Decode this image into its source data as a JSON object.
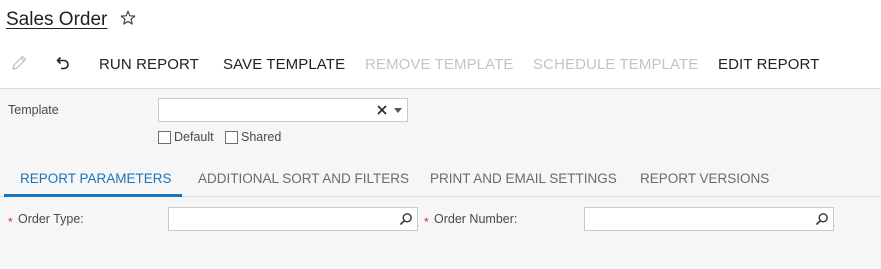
{
  "header": {
    "title": "Sales Order"
  },
  "toolbar": {
    "run_report": "RUN REPORT",
    "save_template": "SAVE TEMPLATE",
    "remove_template": "REMOVE TEMPLATE",
    "schedule_template": "SCHEDULE TEMPLATE",
    "edit_report": "EDIT REPORT"
  },
  "template": {
    "label": "Template",
    "value": "",
    "default_label": "Default",
    "shared_label": "Shared",
    "default_checked": false,
    "shared_checked": false
  },
  "tabs": [
    {
      "label": "REPORT PARAMETERS",
      "active": true
    },
    {
      "label": "ADDITIONAL SORT AND FILTERS",
      "active": false
    },
    {
      "label": "PRINT AND EMAIL SETTINGS",
      "active": false
    },
    {
      "label": "REPORT VERSIONS",
      "active": false
    }
  ],
  "parameters": {
    "required_marker": "*",
    "order_type_label": "Order Type:",
    "order_type_value": "",
    "order_number_label": "Order Number:",
    "order_number_value": ""
  },
  "colors": {
    "accent": "#1a74bc",
    "required": "#d9322e",
    "disabled_text": "#c4c4c4",
    "form_background": "#f6f6f6"
  },
  "icons": [
    "star-icon",
    "edit-icon",
    "undo-icon",
    "clear-icon",
    "chevron-down-icon",
    "search-icon"
  ]
}
